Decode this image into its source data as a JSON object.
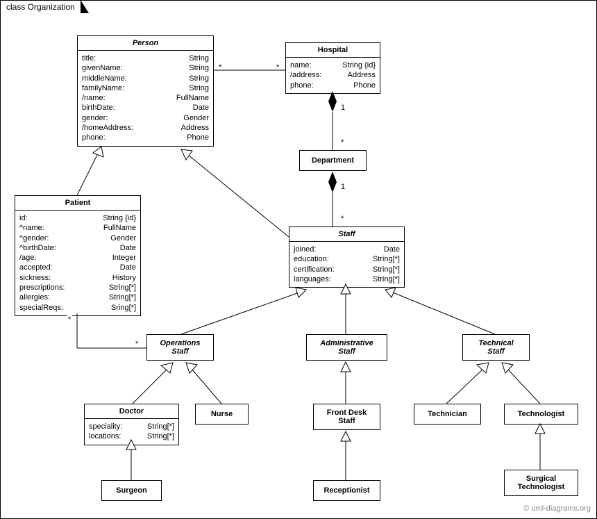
{
  "package": {
    "name": "class Organization"
  },
  "classes": {
    "person": {
      "name": "Person",
      "attrs": [
        {
          "n": "title:",
          "t": "String"
        },
        {
          "n": "givenName:",
          "t": "String"
        },
        {
          "n": "middleName:",
          "t": "String"
        },
        {
          "n": "familyName:",
          "t": "String"
        },
        {
          "n": "/name:",
          "t": "FullName"
        },
        {
          "n": "birthDate:",
          "t": "Date"
        },
        {
          "n": "gender:",
          "t": "Gender"
        },
        {
          "n": "/homeAddress:",
          "t": "Address"
        },
        {
          "n": "phone:",
          "t": "Phone"
        }
      ]
    },
    "hospital": {
      "name": "Hospital",
      "attrs": [
        {
          "n": "name:",
          "t": "String {id}"
        },
        {
          "n": "/address:",
          "t": "Address"
        },
        {
          "n": "phone:",
          "t": "Phone"
        }
      ]
    },
    "patient": {
      "name": "Patient",
      "attrs": [
        {
          "n": "id:",
          "t": "String {id}"
        },
        {
          "n": "^name:",
          "t": "FullName"
        },
        {
          "n": "^gender:",
          "t": "Gender"
        },
        {
          "n": "^birthDate:",
          "t": "Date"
        },
        {
          "n": "/age:",
          "t": "Integer"
        },
        {
          "n": "accepted:",
          "t": "Date"
        },
        {
          "n": "sickness:",
          "t": "History"
        },
        {
          "n": "prescriptions:",
          "t": "String[*]"
        },
        {
          "n": "allergies:",
          "t": "String[*]"
        },
        {
          "n": "specialReqs:",
          "t": "Sring[*]"
        }
      ]
    },
    "department": {
      "name": "Department"
    },
    "staff": {
      "name": "Staff",
      "attrs": [
        {
          "n": "joined:",
          "t": "Date"
        },
        {
          "n": "education:",
          "t": "String[*]"
        },
        {
          "n": "certification:",
          "t": "String[*]"
        },
        {
          "n": "languages:",
          "t": "String[*]"
        }
      ]
    },
    "opsStaff": {
      "name": "Operations",
      "name2": "Staff"
    },
    "adminStaff": {
      "name": "Administrative",
      "name2": "Staff"
    },
    "techStaff": {
      "name": "Technical",
      "name2": "Staff"
    },
    "doctor": {
      "name": "Doctor",
      "attrs": [
        {
          "n": "speciality:",
          "t": "String[*]"
        },
        {
          "n": "locations:",
          "t": "String[*]"
        }
      ]
    },
    "nurse": {
      "name": "Nurse"
    },
    "frontDesk": {
      "name": "Front Desk",
      "name2": "Staff"
    },
    "receptionist": {
      "name": "Receptionist"
    },
    "technician": {
      "name": "Technician"
    },
    "technologist": {
      "name": "Technologist"
    },
    "surgTech": {
      "name": "Surgical",
      "name2": "Technologist"
    },
    "surgeon": {
      "name": "Surgeon"
    }
  },
  "mult": {
    "person_hospital_left": "*",
    "person_hospital_right": "*",
    "hospital_dept": "1",
    "dept_hospital": "*",
    "dept_staff": "1",
    "staff_dept": "*",
    "patient_ops_left": "*",
    "patient_ops_right": "*"
  },
  "watermark": "© uml-diagrams.org"
}
